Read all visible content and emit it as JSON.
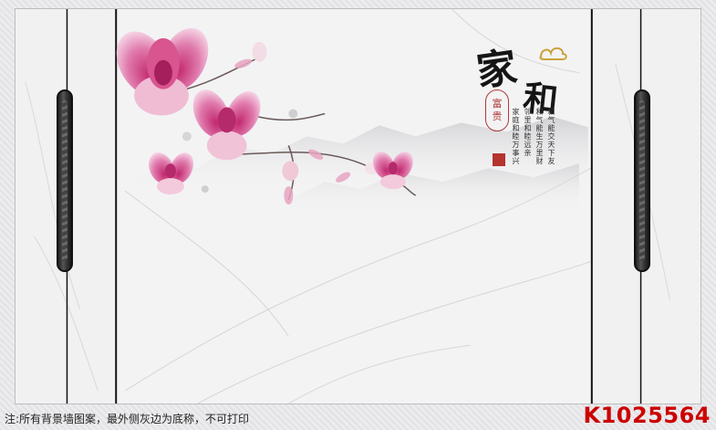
{
  "title": {
    "main_chars": [
      "家",
      "和"
    ],
    "seal_chars": [
      "富",
      "贵"
    ]
  },
  "poem": {
    "columns": [
      "和气能交天下友",
      "和气能生万里财",
      "邻里和睦远亲",
      "家庭和睦万事兴"
    ]
  },
  "caption": "注:所有背景墙图案，最外侧灰边为底称，不可打印",
  "product_code": "K1025564",
  "colors": {
    "flower_pink": "#e06aa0",
    "seal_red": "#b5342f",
    "code_red": "#cc0000"
  }
}
